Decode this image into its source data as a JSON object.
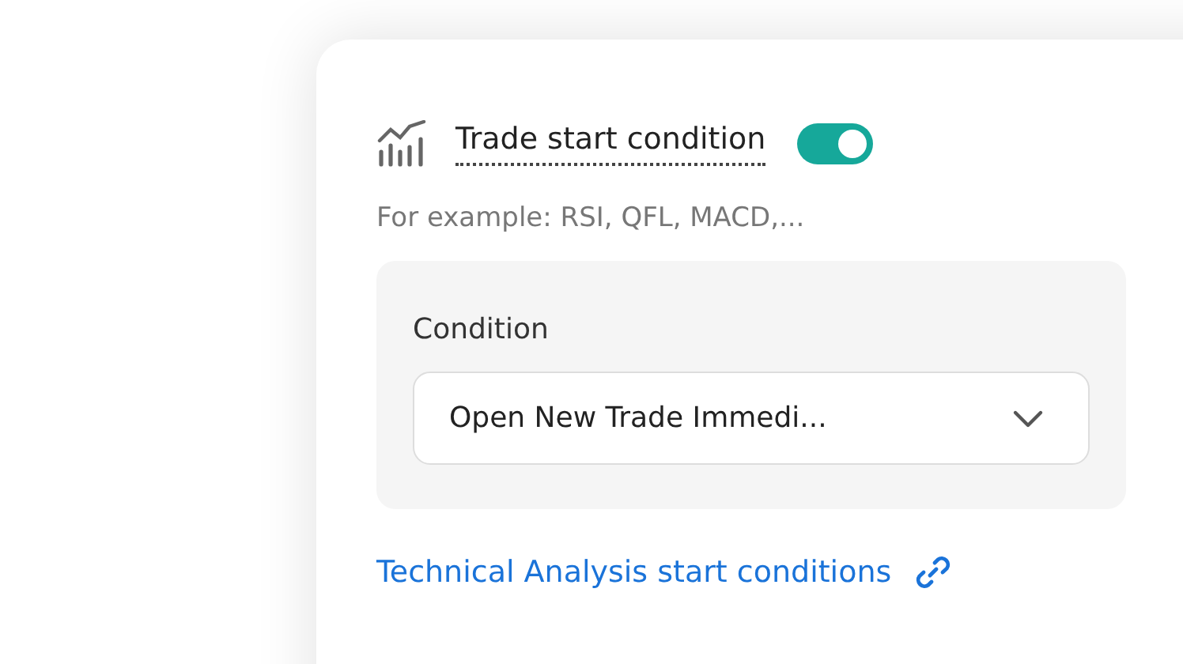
{
  "card": {
    "title": "Trade start condition",
    "toggle": {
      "on": true
    },
    "hint": "For example: RSI, QFL, MACD,...",
    "condition": {
      "label": "Condition",
      "value": "Open New Trade Immedi..."
    },
    "link": "Technical Analysis start conditions"
  }
}
